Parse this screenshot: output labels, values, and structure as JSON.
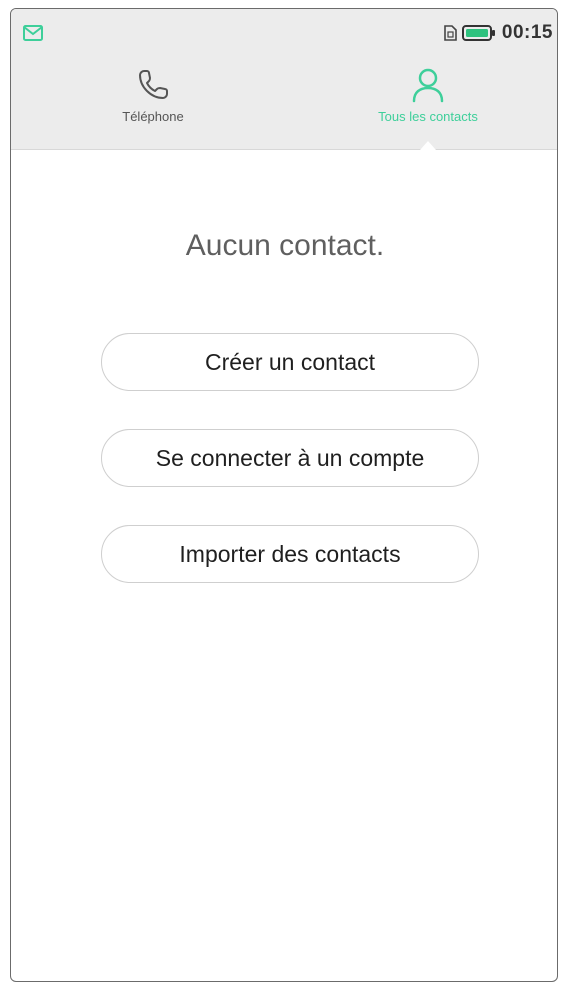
{
  "status_bar": {
    "time": "00:15",
    "icons": [
      "mail-notification-icon",
      "sim-card-icon",
      "battery-icon"
    ],
    "battery_color": "#2ec27e"
  },
  "tabs": [
    {
      "label": "Téléphone",
      "icon": "phone-icon",
      "active": false
    },
    {
      "label": "Tous les contacts",
      "icon": "person-icon",
      "active": true
    }
  ],
  "accent_color": "#3ecf9a",
  "empty_state": {
    "title": "Aucun contact."
  },
  "actions": {
    "create": "Créer un contact",
    "connect": "Se connecter à un compte",
    "import": "Importer des contacts"
  }
}
